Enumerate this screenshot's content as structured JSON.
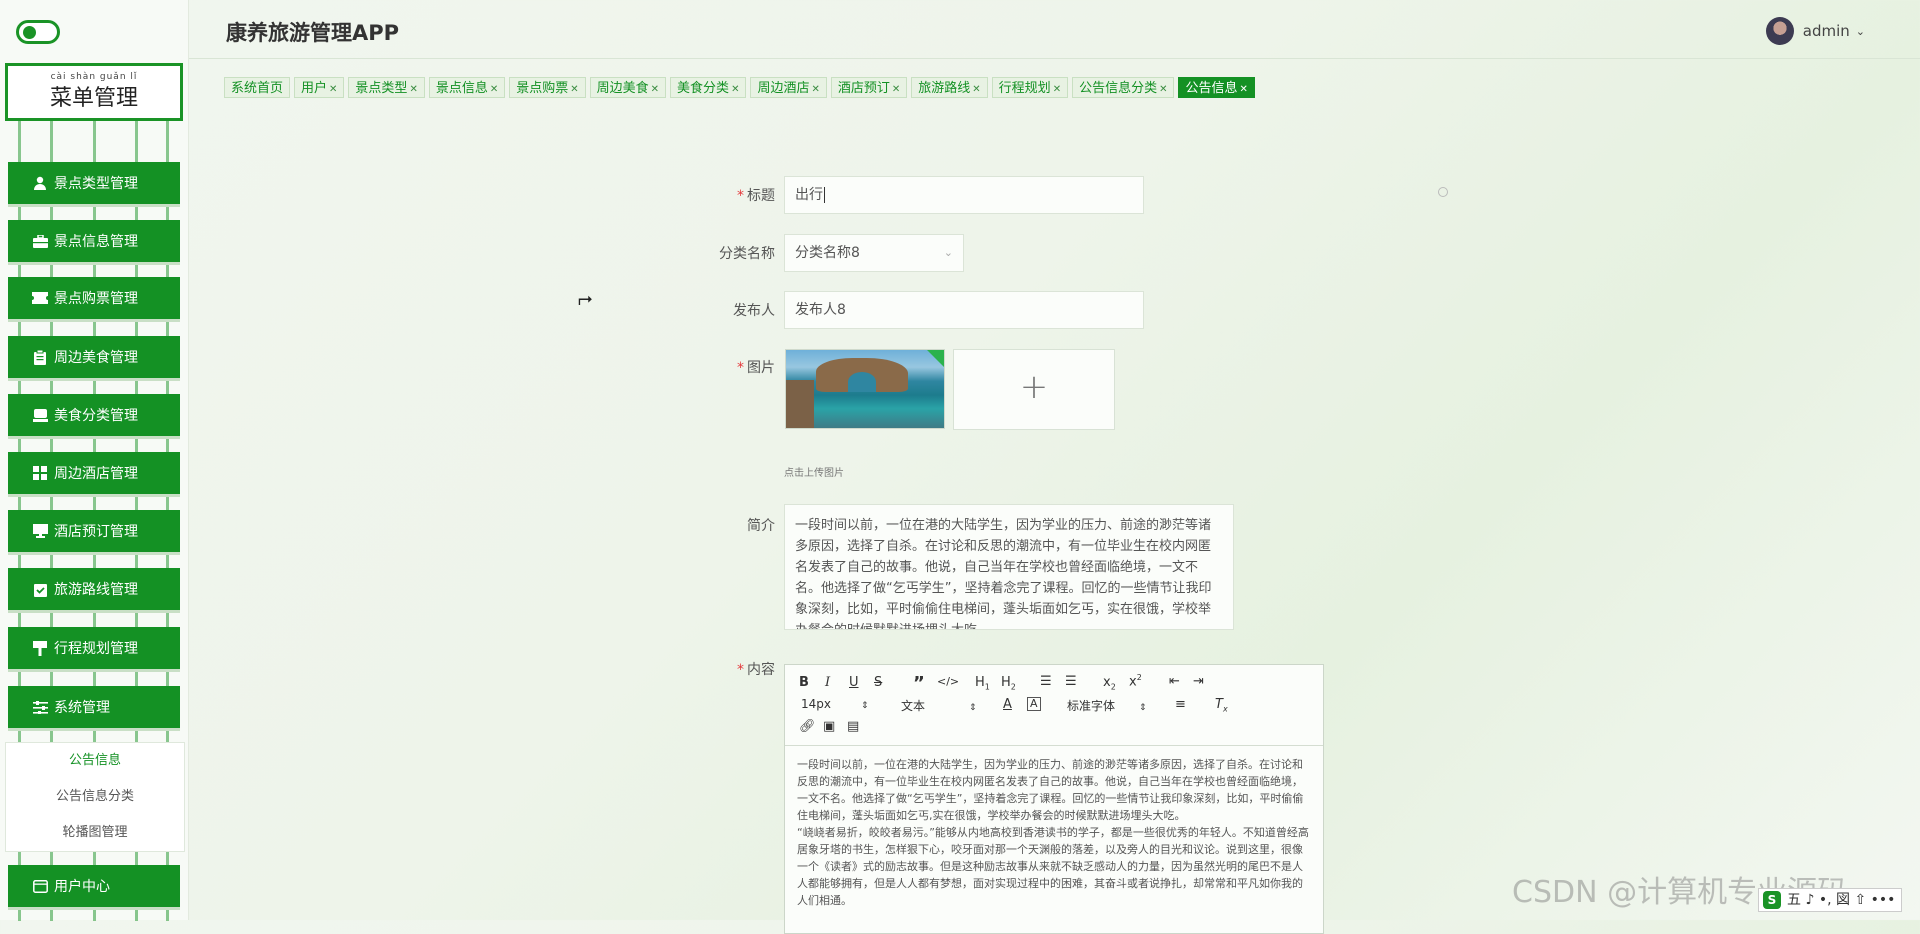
{
  "app": {
    "title": "康养旅游管理APP"
  },
  "user": {
    "name": "admin"
  },
  "sidebar": {
    "menu_title_pinyin": "cài shàn guǎn lǐ",
    "menu_title": "菜单管理",
    "items": [
      {
        "label": "景点类型管理",
        "icon": "user-icon"
      },
      {
        "label": "景点信息管理",
        "icon": "briefcase-icon"
      },
      {
        "label": "景点购票管理",
        "icon": "ticket-icon"
      },
      {
        "label": "周边美食管理",
        "icon": "clipboard-icon"
      },
      {
        "label": "美食分类管理",
        "icon": "tray-icon"
      },
      {
        "label": "周边酒店管理",
        "icon": "grid-icon"
      },
      {
        "label": "酒店预订管理",
        "icon": "monitor-icon"
      },
      {
        "label": "旅游路线管理",
        "icon": "checklist-icon"
      },
      {
        "label": "行程规划管理",
        "icon": "sign-icon"
      },
      {
        "label": "系统管理",
        "icon": "sliders-icon"
      }
    ],
    "submenu": [
      "公告信息",
      "公告信息分类",
      "轮播图管理"
    ],
    "user_center": "用户中心"
  },
  "tabs": [
    {
      "label": "系统首页",
      "closable": false
    },
    {
      "label": "用户",
      "closable": true
    },
    {
      "label": "景点类型",
      "closable": true
    },
    {
      "label": "景点信息",
      "closable": true
    },
    {
      "label": "景点购票",
      "closable": true
    },
    {
      "label": "周边美食",
      "closable": true
    },
    {
      "label": "美食分类",
      "closable": true
    },
    {
      "label": "周边酒店",
      "closable": true
    },
    {
      "label": "酒店预订",
      "closable": true
    },
    {
      "label": "旅游路线",
      "closable": true
    },
    {
      "label": "行程规划",
      "closable": true
    },
    {
      "label": "公告信息分类",
      "closable": true
    },
    {
      "label": "公告信息",
      "closable": true,
      "active": true
    }
  ],
  "form": {
    "title_label": "标题",
    "title_value": "出行",
    "category_label": "分类名称",
    "category_value": "分类名称8",
    "publisher_label": "发布人",
    "publisher_value": "发布人8",
    "image_label": "图片",
    "upload_hint": "点击上传图片",
    "intro_label": "简介",
    "intro_value": "一段时间以前，一位在港的大陆学生，因为学业的压力、前途的渺茫等诸多原因，选择了自杀。在讨论和反思的潮流中，有一位毕业生在校内网匿名发表了自己的故事。他说，自己当年在学校也曾经面临绝境，一文不名。他选择了做“乞丐学生”，坚持着念完了课程。回忆的一些情节让我印象深刻，比如，平时偷偷住电梯间，蓬头垢面如乞丐，实在很饿，学校举办餐会的时候默默进场埋头大吃。",
    "content_label": "内容",
    "editor": {
      "font_size": "14px",
      "paragraph": "文本",
      "font_family": "标准字体",
      "content_p1": "一段时间以前，一位在港的大陆学生，因为学业的压力、前途的渺茫等诸多原因，选择了自杀。在讨论和反思的潮流中，有一位毕业生在校内网匿名发表了自己的故事。他说，自己当年在学校也曾经面临绝境，一文不名。他选择了做“乞丐学生”，坚持着念完了课程。回忆的一些情节让我印象深刻，比如，平时偷偷住电梯间，蓬头垢面如乞丐,实在很饿，学校举办餐会的时候默默进场埋头大吃。",
      "content_p2": "“峣峣者易折，皎皎者易污。”能够从内地高校到香港读书的学子，都是一些很优秀的年轻人。不知道曾经高居象牙塔的书生，怎样狠下心，咬牙面对那一个天渊般的落差，以及旁人的目光和议论。说到这里，很像一个《读者》式的励志故事。但是这种励志故事从来就不缺乏感动人的力量，因为虽然光明的尾巴不是人人都能够拥有，但是人人都有梦想，面对实现过程中的困难，其奋斗或者说挣扎，却常常和平凡如你我的人们相通。"
    }
  },
  "watermark": "CSDN @计算机专业源码",
  "ime": {
    "label": "五 ♪ •, 図 ⇧ •••"
  },
  "colors": {
    "accent": "#149124",
    "required": "#e4393c"
  }
}
